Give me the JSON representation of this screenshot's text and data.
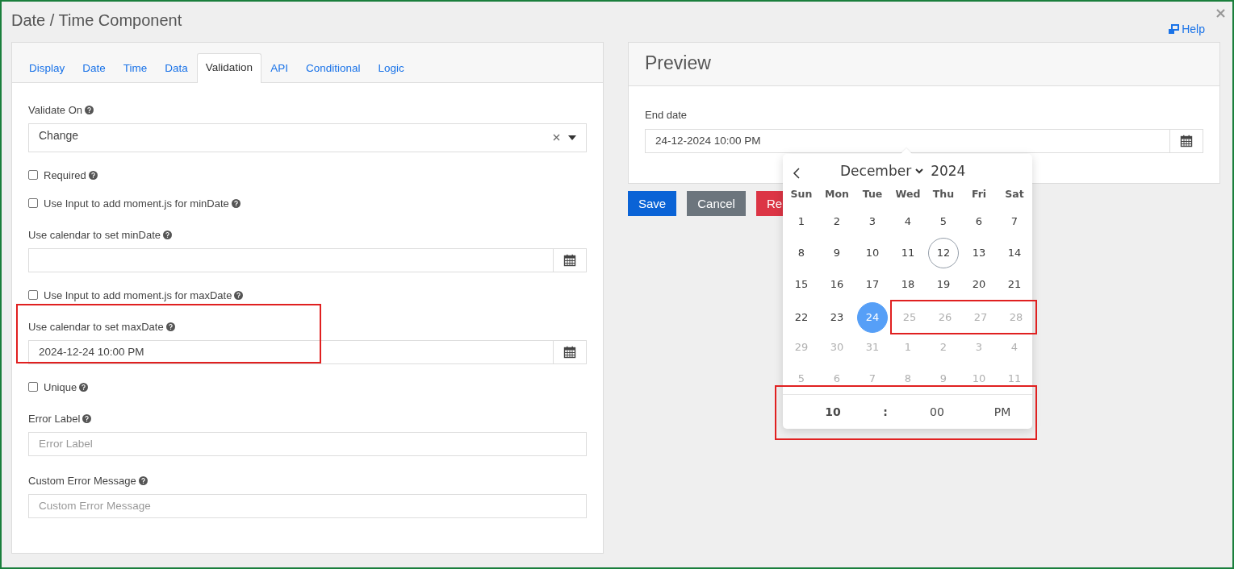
{
  "window": {
    "title": "Date / Time Component",
    "help_link": "Help"
  },
  "tabs": [
    {
      "label": "Display",
      "selected": false
    },
    {
      "label": "Date",
      "selected": false
    },
    {
      "label": "Time",
      "selected": false
    },
    {
      "label": "Data",
      "selected": false
    },
    {
      "label": "Validation",
      "selected": true
    },
    {
      "label": "API",
      "selected": false
    },
    {
      "label": "Conditional",
      "selected": false
    },
    {
      "label": "Logic",
      "selected": false
    }
  ],
  "form": [
    {
      "kind": "select",
      "label": "Validate On",
      "value": "Change",
      "highlighted": false
    },
    {
      "kind": "checkbox",
      "label": "Required",
      "checked": false,
      "highlighted": false
    },
    {
      "kind": "checkbox",
      "label": "Use Input to add moment.js for minDate",
      "checked": false,
      "highlighted": false
    },
    {
      "kind": "date",
      "label": "Use calendar to set minDate",
      "highlighted": false
    },
    {
      "kind": "checkbox",
      "label": "Use Input to add moment.js for maxDate",
      "checked": false,
      "highlighted": false
    },
    {
      "kind": "date",
      "label": "Use calendar to set maxDate",
      "value": "2024-12-24 10:00 PM",
      "highlighted": true
    },
    {
      "kind": "checkbox",
      "label": "Unique",
      "checked": false,
      "highlighted": false
    },
    {
      "kind": "text",
      "label": "Error Label",
      "placeholder": "Error Label",
      "highlighted": false
    },
    {
      "kind": "text",
      "label": "Custom Error Message",
      "placeholder": "Custom Error Message",
      "highlighted": false
    }
  ],
  "preview": {
    "title": "Preview",
    "field_label": "End date",
    "field_value": "24-12-2024 10:00 PM",
    "buttons": [
      {
        "label": "Save",
        "kind": "primary"
      },
      {
        "label": "Cancel",
        "kind": "secondary"
      },
      {
        "label": "Re",
        "kind": "danger"
      }
    ]
  },
  "calendar": {
    "month": "December",
    "year": "2024",
    "weekdays": [
      "Sun",
      "Mon",
      "Tue",
      "Wed",
      "Thu",
      "Fri",
      "Sat"
    ],
    "weeks": [
      [
        {
          "label": "1",
          "disabled": false,
          "selected": false,
          "today": false,
          "highlighted": false
        },
        {
          "label": "2",
          "disabled": false,
          "selected": false,
          "today": false,
          "highlighted": false
        },
        {
          "label": "3",
          "disabled": false,
          "selected": false,
          "today": false,
          "highlighted": false
        },
        {
          "label": "4",
          "disabled": false,
          "selected": false,
          "today": false,
          "highlighted": false
        },
        {
          "label": "5",
          "disabled": false,
          "selected": false,
          "today": false,
          "highlighted": false
        },
        {
          "label": "6",
          "disabled": false,
          "selected": false,
          "today": false,
          "highlighted": false
        },
        {
          "label": "7",
          "disabled": false,
          "selected": false,
          "today": false,
          "highlighted": false
        }
      ],
      [
        {
          "label": "8",
          "disabled": false,
          "selected": false,
          "today": false,
          "highlighted": false
        },
        {
          "label": "9",
          "disabled": false,
          "selected": false,
          "today": false,
          "highlighted": false
        },
        {
          "label": "10",
          "disabled": false,
          "selected": false,
          "today": false,
          "highlighted": false
        },
        {
          "label": "11",
          "disabled": false,
          "selected": false,
          "today": false,
          "highlighted": false
        },
        {
          "label": "12",
          "disabled": false,
          "selected": false,
          "today": true,
          "highlighted": false
        },
        {
          "label": "13",
          "disabled": false,
          "selected": false,
          "today": false,
          "highlighted": false
        },
        {
          "label": "14",
          "disabled": false,
          "selected": false,
          "today": false,
          "highlighted": false
        }
      ],
      [
        {
          "label": "15",
          "disabled": false,
          "selected": false,
          "today": false,
          "highlighted": false
        },
        {
          "label": "16",
          "disabled": false,
          "selected": false,
          "today": false,
          "highlighted": false
        },
        {
          "label": "17",
          "disabled": false,
          "selected": false,
          "today": false,
          "highlighted": false
        },
        {
          "label": "18",
          "disabled": false,
          "selected": false,
          "today": false,
          "highlighted": false
        },
        {
          "label": "19",
          "disabled": false,
          "selected": false,
          "today": false,
          "highlighted": false
        },
        {
          "label": "20",
          "disabled": false,
          "selected": false,
          "today": false,
          "highlighted": false
        },
        {
          "label": "21",
          "disabled": false,
          "selected": false,
          "today": false,
          "highlighted": false
        }
      ],
      [
        {
          "label": "22",
          "disabled": false,
          "selected": false,
          "today": false,
          "highlighted": false
        },
        {
          "label": "23",
          "disabled": false,
          "selected": false,
          "today": false,
          "highlighted": false
        },
        {
          "label": "24",
          "disabled": false,
          "selected": true,
          "today": false,
          "highlighted": false
        },
        {
          "label": "25",
          "disabled": true,
          "selected": false,
          "today": false,
          "highlighted": true
        },
        {
          "label": "26",
          "disabled": true,
          "selected": false,
          "today": false,
          "highlighted": true
        },
        {
          "label": "27",
          "disabled": true,
          "selected": false,
          "today": false,
          "highlighted": true
        },
        {
          "label": "28",
          "disabled": true,
          "selected": false,
          "today": false,
          "highlighted": true
        }
      ],
      [
        {
          "label": "29",
          "disabled": true,
          "selected": false,
          "today": false,
          "highlighted": false
        },
        {
          "label": "30",
          "disabled": true,
          "selected": false,
          "today": false,
          "highlighted": false
        },
        {
          "label": "31",
          "disabled": true,
          "selected": false,
          "today": false,
          "highlighted": false
        },
        {
          "label": "1",
          "disabled": true,
          "selected": false,
          "today": false,
          "highlighted": false
        },
        {
          "label": "2",
          "disabled": true,
          "selected": false,
          "today": false,
          "highlighted": false
        },
        {
          "label": "3",
          "disabled": true,
          "selected": false,
          "today": false,
          "highlighted": false
        },
        {
          "label": "4",
          "disabled": true,
          "selected": false,
          "today": false,
          "highlighted": false
        }
      ],
      [
        {
          "label": "5",
          "disabled": true,
          "selected": false,
          "today": false,
          "highlighted": false
        },
        {
          "label": "6",
          "disabled": true,
          "selected": false,
          "today": false,
          "highlighted": false
        },
        {
          "label": "7",
          "disabled": true,
          "selected": false,
          "today": false,
          "highlighted": false
        },
        {
          "label": "8",
          "disabled": true,
          "selected": false,
          "today": false,
          "highlighted": false
        },
        {
          "label": "9",
          "disabled": true,
          "selected": false,
          "today": false,
          "highlighted": false
        },
        {
          "label": "10",
          "disabled": true,
          "selected": false,
          "today": false,
          "highlighted": false
        },
        {
          "label": "11",
          "disabled": true,
          "selected": false,
          "today": false,
          "highlighted": false
        }
      ]
    ],
    "time": {
      "hour": "10",
      "separator": ":",
      "minute": "00",
      "ampm": "PM",
      "highlighted": true
    }
  }
}
